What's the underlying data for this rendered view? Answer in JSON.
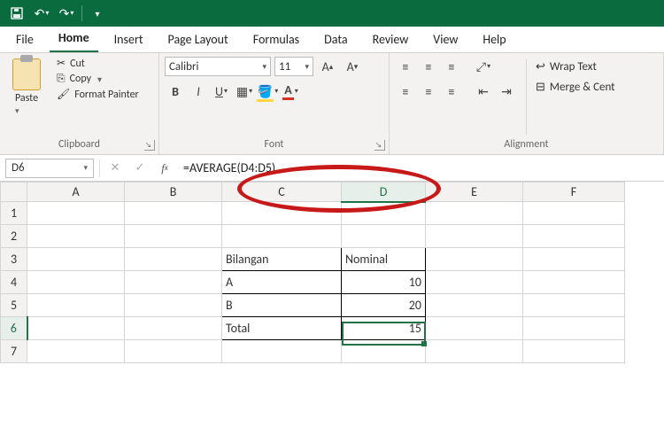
{
  "tabs": [
    "File",
    "Home",
    "Insert",
    "Page Layout",
    "Formulas",
    "Data",
    "Review",
    "View",
    "Help"
  ],
  "active_tab": "Home",
  "ribbon": {
    "paste": "Paste",
    "cut": "Cut",
    "copy": "Copy",
    "format_painter": "Format Painter",
    "clipboard": "Clipboard",
    "font_name": "Calibri",
    "font_size": "11",
    "font_group": "Font",
    "wrap_text": "Wrap Text",
    "merge_center": "Merge & Cent",
    "alignment": "Alignment"
  },
  "namebox": "D6",
  "formula": "=AVERAGE(D4:D5)",
  "columns": [
    "A",
    "B",
    "C",
    "D",
    "E",
    "F"
  ],
  "rows": [
    "1",
    "2",
    "3",
    "4",
    "5",
    "6",
    "7"
  ],
  "cells": {
    "C3": "Bilangan",
    "D3": "Nominal",
    "C4": "A",
    "D4": "10",
    "C5": "B",
    "D5": "20",
    "C6": "Total",
    "D6": "15"
  },
  "selected": {
    "col": "D",
    "row": "6"
  }
}
